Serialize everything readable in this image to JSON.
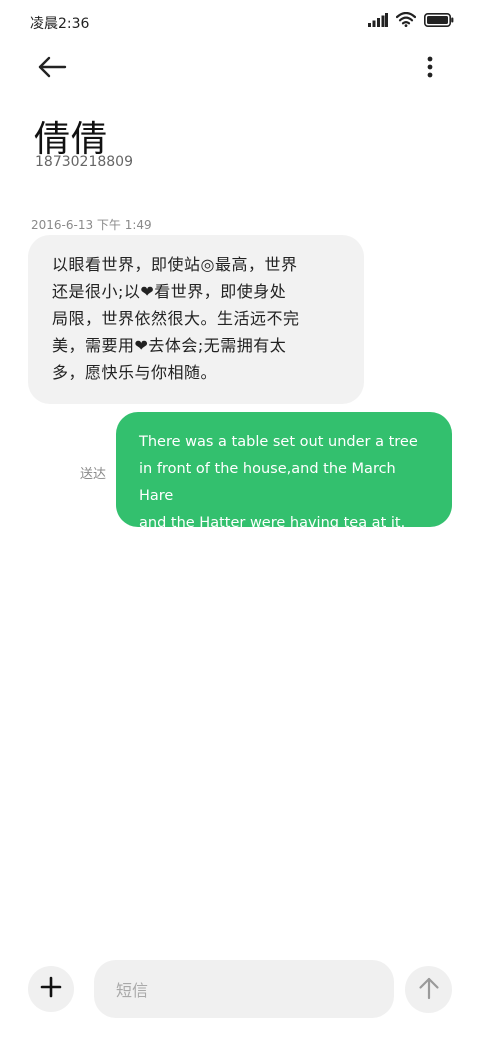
{
  "status_bar": {
    "time": "凌晨2:36",
    "icons": [
      "signal-icon",
      "wifi-icon",
      "battery-icon"
    ]
  },
  "header": {
    "back_icon": "arrow-left-icon",
    "more_icon": "more-vertical-icon",
    "contact_name": "倩倩",
    "contact_number": "18730218809"
  },
  "conversation": {
    "timestamp": "2016-6-13  下午 1:49",
    "incoming_message": {
      "lines": [
        "以眼看世界，即使站◎最高，世界",
        "还是很小;以❤看世界，即使身处",
        "局限，世界依然很大。生活远不完",
        "美，需要用❤去体会;无需拥有太",
        "多，愿快乐与你相随。"
      ]
    },
    "outgoing_message": {
      "lines": [
        "There was a table set out under a tree",
        "in front of the house,and the March Hare",
        "and the Hatter were having tea at it."
      ],
      "status": "送达"
    }
  },
  "composer": {
    "add_icon": "plus-icon",
    "placeholder": "短信",
    "send_icon": "arrow-up-icon"
  },
  "colors": {
    "outgoing_bubble": "#33c06e",
    "incoming_bubble": "#f2f2f2",
    "background": "#ffffff"
  }
}
